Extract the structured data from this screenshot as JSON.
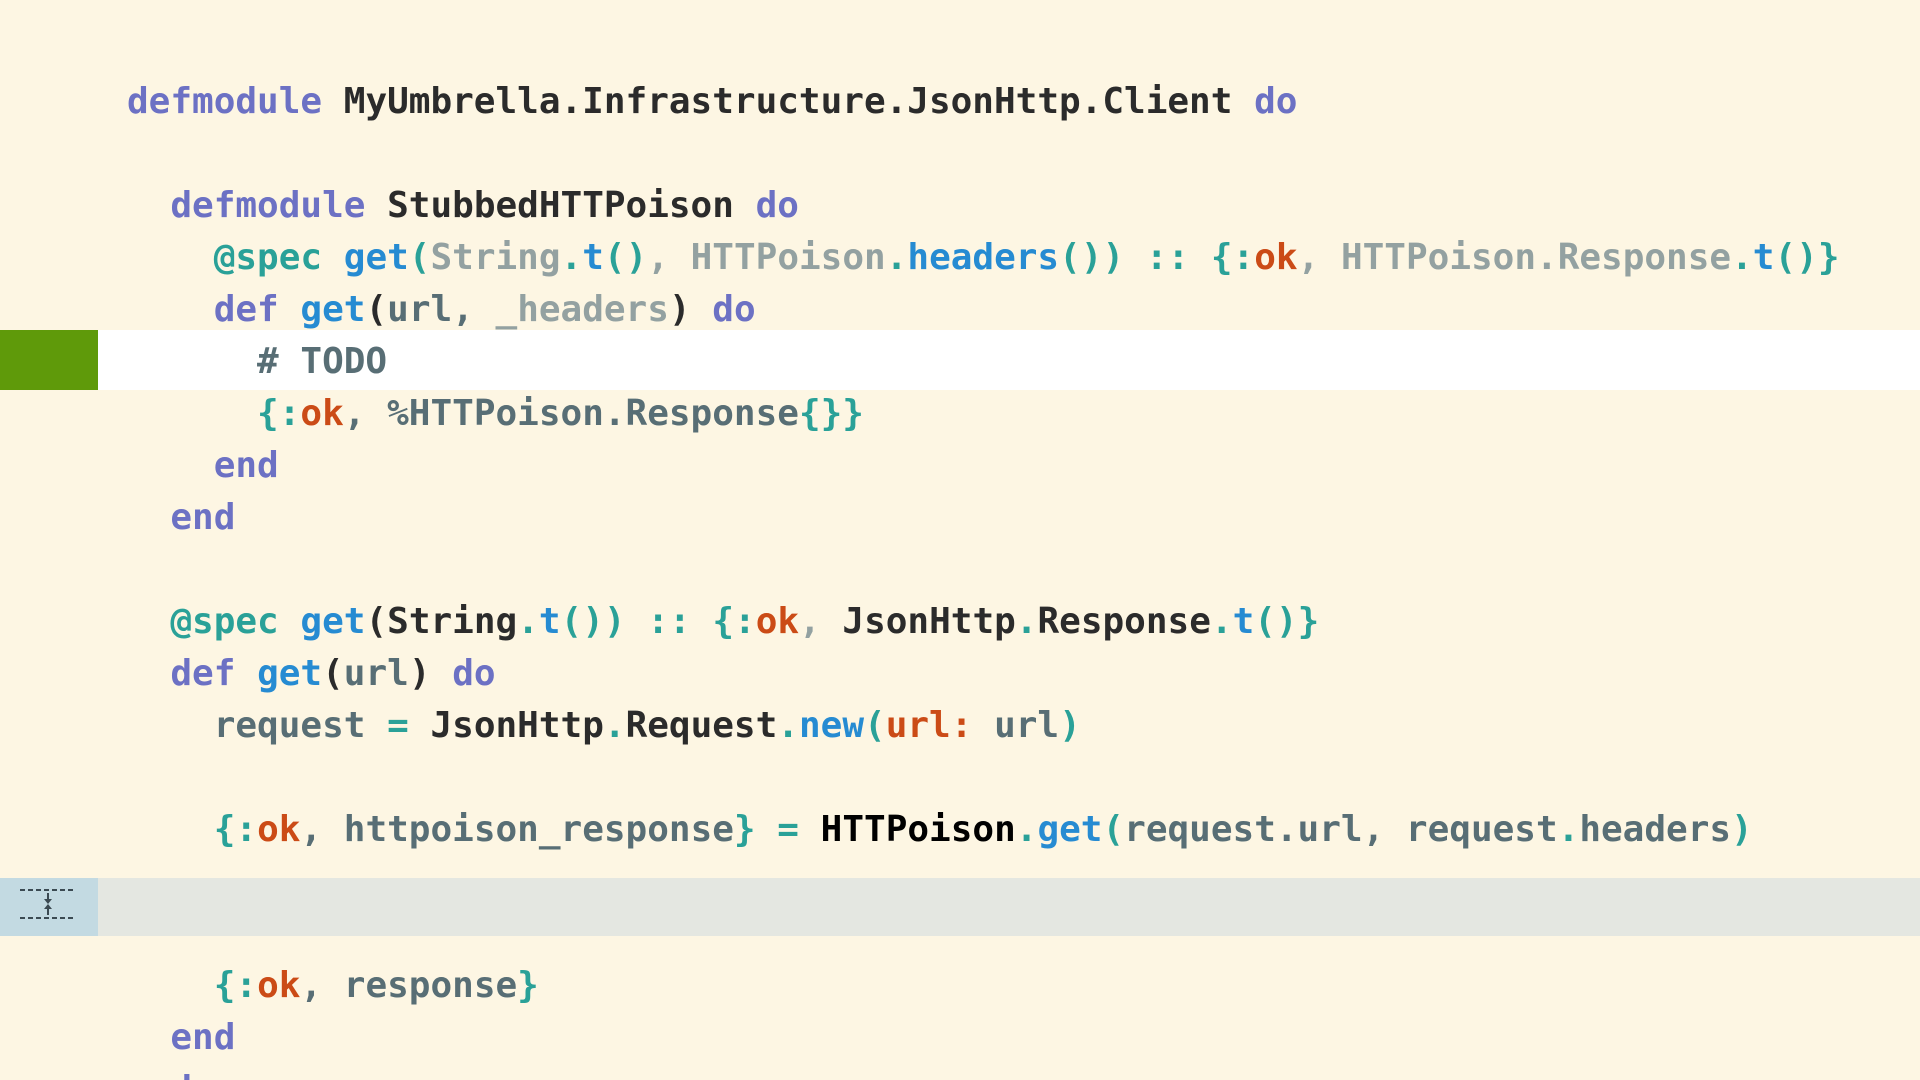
{
  "editor": {
    "language": "elixir",
    "theme": "solarized-light",
    "colors": {
      "background": "#fdf6e3",
      "current_line": "#ffffff",
      "current_line_gutter": "#5f9a0a",
      "fold_line": "#e4e7e1",
      "fold_gutter": "#c3dae2",
      "keyword": "#6c71c4",
      "function": "#268bd2",
      "atom": "#cb4b16",
      "operator": "#2aa198"
    },
    "fold_marker_icon": "unfold-icon"
  },
  "tokens": {
    "l1": [
      "defmodule",
      " ",
      "MyUmbrella.Infrastructure.JsonHttp.Client",
      " ",
      "do"
    ],
    "l3": [
      "  ",
      "defmodule",
      " ",
      "StubbedHTTPoison",
      " ",
      "do"
    ],
    "l4": [
      "    ",
      "@spec",
      " ",
      "get",
      "(",
      "String",
      ".",
      "t",
      "()",
      ", ",
      "HTTPoison",
      ".",
      "headers",
      "())",
      " ",
      "::",
      " ",
      "{:",
      "ok",
      ", ",
      "HTTPoison.Response",
      ".",
      "t",
      "()}"
    ],
    "l5": [
      "    ",
      "def",
      " ",
      "get",
      "(",
      "url, ",
      "_headers",
      ")",
      " ",
      "do"
    ],
    "l6": [
      "      ",
      "# TODO"
    ],
    "l7": [
      "      ",
      "{:",
      "ok",
      ", ",
      "%HTTPoison.Response",
      "{}}"
    ],
    "l8": [
      "    ",
      "end"
    ],
    "l9": [
      "  ",
      "end"
    ],
    "l11": [
      "  ",
      "@spec",
      " ",
      "get",
      "(",
      "String",
      ".",
      "t",
      "())",
      " ",
      "::",
      " ",
      "{:",
      "ok",
      ", ",
      "JsonHttp",
      ".",
      "Response",
      ".",
      "t",
      "()}"
    ],
    "l12": [
      "  ",
      "def",
      " ",
      "get",
      "(",
      "url",
      ")",
      " ",
      "do"
    ],
    "l13": [
      "    ",
      "request",
      " ",
      "=",
      " ",
      "JsonHttp",
      ".",
      "Request",
      ".",
      "new",
      "(",
      "url:",
      " ",
      "url",
      ")"
    ],
    "l15": [
      "    ",
      "{:",
      "ok",
      ", ",
      "httpoison_response",
      "}",
      " ",
      "=",
      " ",
      "HTTPoison",
      ".",
      "get",
      "(",
      "request.url, request",
      ".",
      "headers",
      ")"
    ],
    "l17": [
      "    ",
      "{:",
      "ok",
      ", ",
      "response",
      "}"
    ],
    "l18": [
      "  ",
      "end"
    ],
    "l19": [
      "end"
    ]
  }
}
